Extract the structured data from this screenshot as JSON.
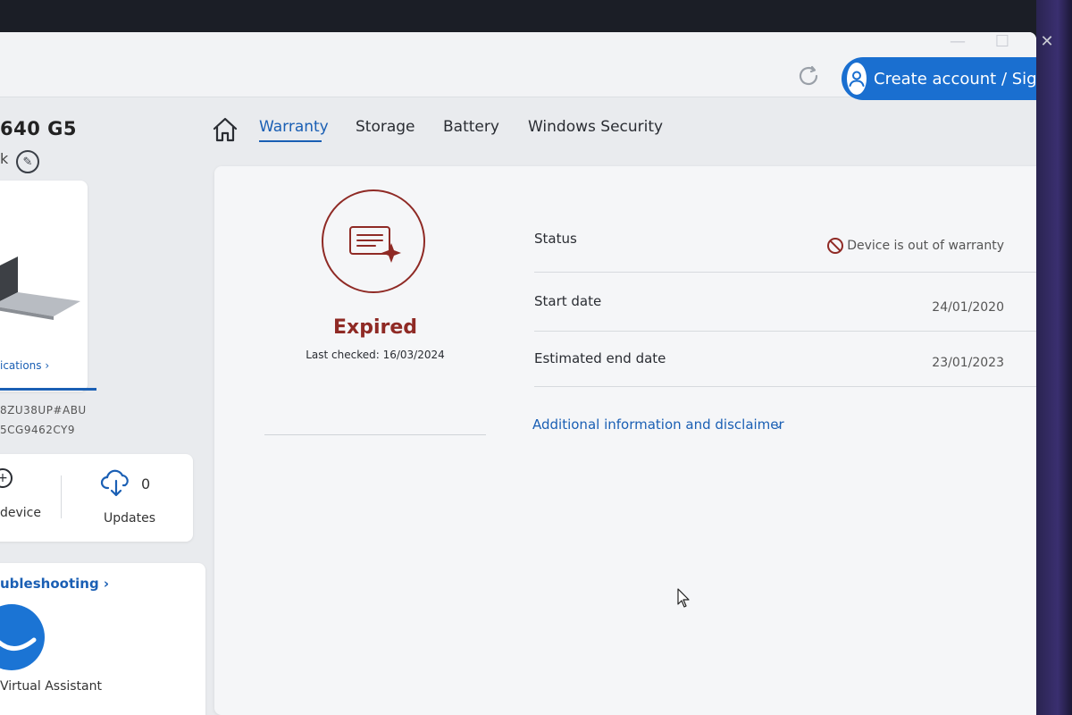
{
  "header": {
    "signin_label": "Create account / Sign in",
    "window_controls": [
      "—",
      "☐",
      "✕"
    ]
  },
  "sidebar": {
    "device_name": "640 G5",
    "device_sub": "k",
    "specs_link": "ications ›",
    "sku": "8ZU38UP#ABU",
    "serial": "5CG9462CY9",
    "add_device_label": "device",
    "updates_count": "0",
    "updates_label": "Updates",
    "troubleshooting_link": "ubleshooting ›",
    "assistant_label": "Virtual Assistant"
  },
  "tabs": [
    {
      "label": "Warranty",
      "active": true
    },
    {
      "label": "Storage",
      "active": false
    },
    {
      "label": "Battery",
      "active": false
    },
    {
      "label": "Windows Security",
      "active": false
    }
  ],
  "warranty": {
    "status_big": "Expired",
    "last_checked": "Last checked: 16/03/2024",
    "rows": [
      {
        "label": "Status",
        "value": "Device is out of warranty"
      },
      {
        "label": "Start date",
        "value": "24/01/2020"
      },
      {
        "label": "Estimated end date",
        "value": "23/01/2023"
      }
    ],
    "disclaimer": "Additional information and disclaimer"
  },
  "colors": {
    "accent": "#1a5fb4",
    "signin_bg": "#1a6fd0",
    "expired": "#8f2a25"
  }
}
